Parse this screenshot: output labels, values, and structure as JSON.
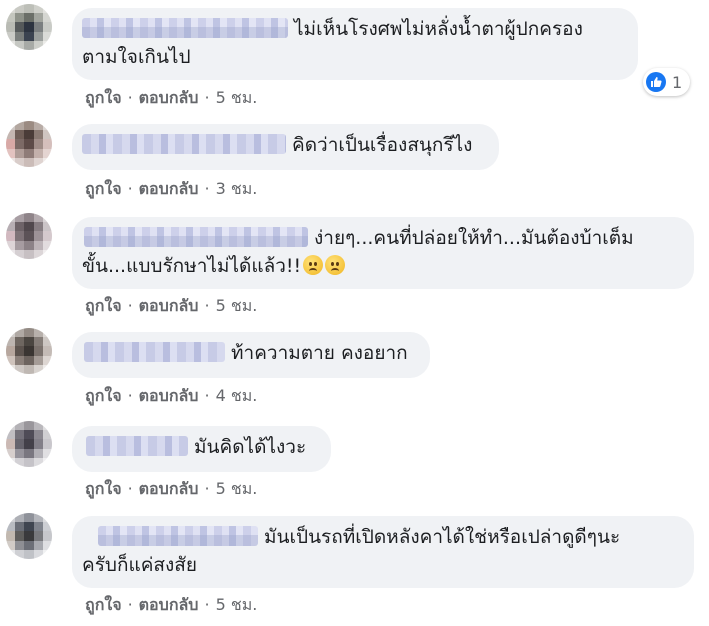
{
  "comments": [
    {
      "name_blurred": true,
      "text_line1": "ไม่เห็นโรงศพไม่หลั่งน้ำตาผู้ปกครอง",
      "text_line2": "ตามใจเกินไป",
      "actions": {
        "like": "ถูกใจ",
        "reply": "ตอบกลับ",
        "time": "5 ชม."
      },
      "reaction": {
        "icon": "thumbs-up-icon",
        "count": "1",
        "color": "#1877f2"
      }
    },
    {
      "name_blurred": true,
      "text_line1": "คิดว่าเป็นเรื่องสนุกรึไง",
      "actions": {
        "like": "ถูกใจ",
        "reply": "ตอบกลับ",
        "time": "3 ชม."
      }
    },
    {
      "name_blurred": true,
      "text_line1": "ง่ายๆ...คนที่ปล่อยให้ทำ...มันต้องบ้าเต็ม",
      "text_line2": "ขั้น...แบบรักษาไม่ได้แล้ว!!",
      "emojis": [
        "frowning-face-emoji",
        "frowning-face-emoji"
      ],
      "actions": {
        "like": "ถูกใจ",
        "reply": "ตอบกลับ",
        "time": "5 ชม."
      }
    },
    {
      "name_blurred": true,
      "text_line1": "ท้าความตาย คงอยาก",
      "actions": {
        "like": "ถูกใจ",
        "reply": "ตอบกลับ",
        "time": "4 ชม."
      }
    },
    {
      "name_blurred": true,
      "text_line1": "มันคิดได้ไงวะ",
      "actions": {
        "like": "ถูกใจ",
        "reply": "ตอบกลับ",
        "time": "5 ชม."
      }
    },
    {
      "name_blurred": true,
      "text_line1": "มันเป็นรถที่เปิดหลังคาได้ใช่หรือเปล่าดูดีๆนะ",
      "text_line2": "ครับก็แค่สงสัย",
      "actions": {
        "like": "ถูกใจ",
        "reply": "ตอบกลับ",
        "time": "5 ชม."
      }
    }
  ],
  "separator": "·",
  "colors": {
    "bubble": "#f0f2f5",
    "text": "#1c1e21",
    "meta": "#65676b",
    "like_blue": "#1877f2"
  }
}
